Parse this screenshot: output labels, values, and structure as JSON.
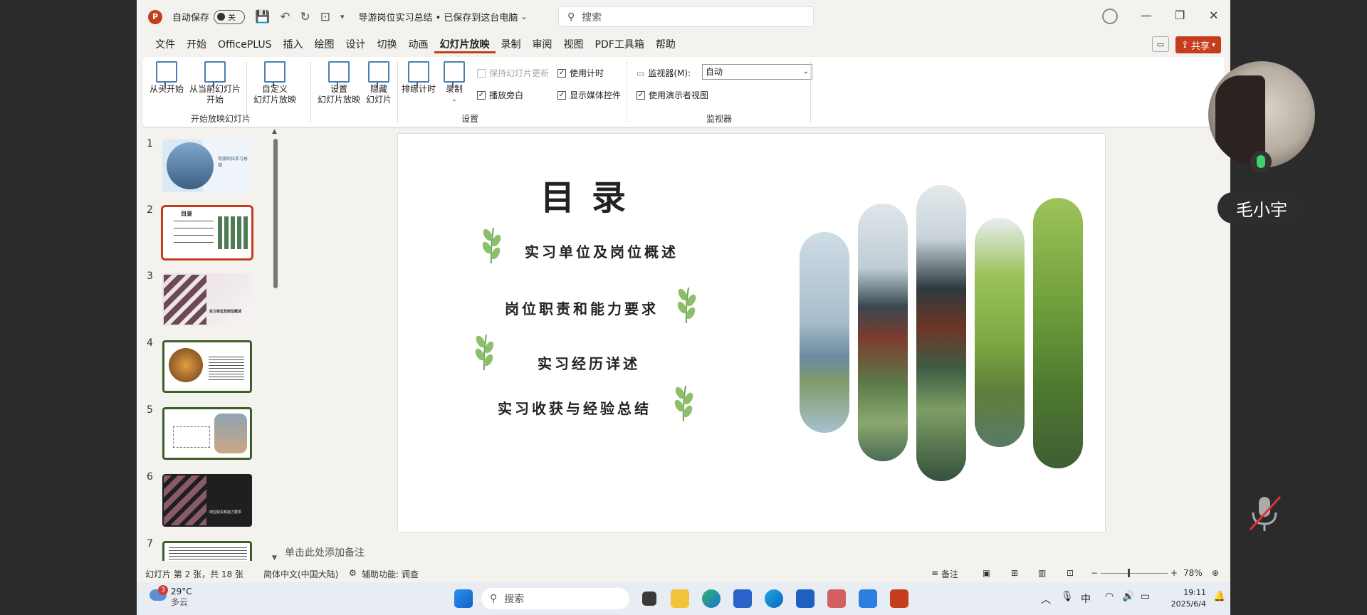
{
  "titlebar": {
    "autosave_label": "自动保存",
    "toggle_label": "关",
    "doc_title": "导游岗位实习总结 • 已保存到这台电脑",
    "search_placeholder": "搜索"
  },
  "menu": {
    "items": [
      "文件",
      "开始",
      "OfficePLUS",
      "插入",
      "绘图",
      "设计",
      "切换",
      "动画",
      "幻灯片放映",
      "录制",
      "审阅",
      "视图",
      "PDF工具箱",
      "帮助"
    ],
    "active": "幻灯片放映",
    "share_label": "共享"
  },
  "ribbon": {
    "btn_from_start": "从头开始",
    "btn_from_current_1": "从当前幻灯片",
    "btn_from_current_2": "开始",
    "btn_custom_1": "自定义",
    "btn_custom_2": "幻灯片放映",
    "group_start": "开始放映幻灯片",
    "btn_setup_1": "设置",
    "btn_setup_2": "幻灯片放映",
    "btn_hide_1": "隐藏",
    "btn_hide_2": "幻灯片",
    "btn_rehearse": "排练计时",
    "btn_record": "录制",
    "chk_keep_updated": "保持幻灯片更新",
    "chk_play_narration": "播放旁白",
    "chk_use_timing": "使用计时",
    "chk_show_media": "显示媒体控件",
    "group_setup": "设置",
    "monitor_label": "监视器(M):",
    "monitor_value": "自动",
    "chk_presenter_view": "使用演示者视图",
    "group_monitor": "监视器"
  },
  "thumbnails": [
    {
      "num": "1",
      "title": "导游岗位实习总结"
    },
    {
      "num": "2",
      "title": "目录"
    },
    {
      "num": "3",
      "title": "实习单位及岗位概述"
    },
    {
      "num": "4",
      "title": ""
    },
    {
      "num": "5",
      "title": ""
    },
    {
      "num": "6",
      "title": "岗位职责和能力要求"
    },
    {
      "num": "7",
      "title": ""
    }
  ],
  "slide": {
    "title": "目录",
    "items": [
      "实习单位及岗位概述",
      "岗位职责和能力要求",
      "实习经历详述",
      "实习收获与经验总结"
    ]
  },
  "notes_placeholder": "单击此处添加备注",
  "status": {
    "slide_info": "幻灯片 第 2 张，共 18 张",
    "language": "简体中文(中国大陆)",
    "accessibility": "辅助功能: 调查",
    "notes_btn": "备注",
    "zoom": "78%"
  },
  "taskbar": {
    "temperature": "29°C",
    "weather": "多云",
    "weather_badge": "3",
    "search": "搜索",
    "ime": "中",
    "time": "19:11",
    "date": "2025/6/4"
  },
  "meeting": {
    "participant_name": "毛小宇"
  },
  "colors": {
    "accent": "#c43e1c",
    "save_icon": "#a33fa0",
    "slide_green": "#3e5e2a"
  }
}
